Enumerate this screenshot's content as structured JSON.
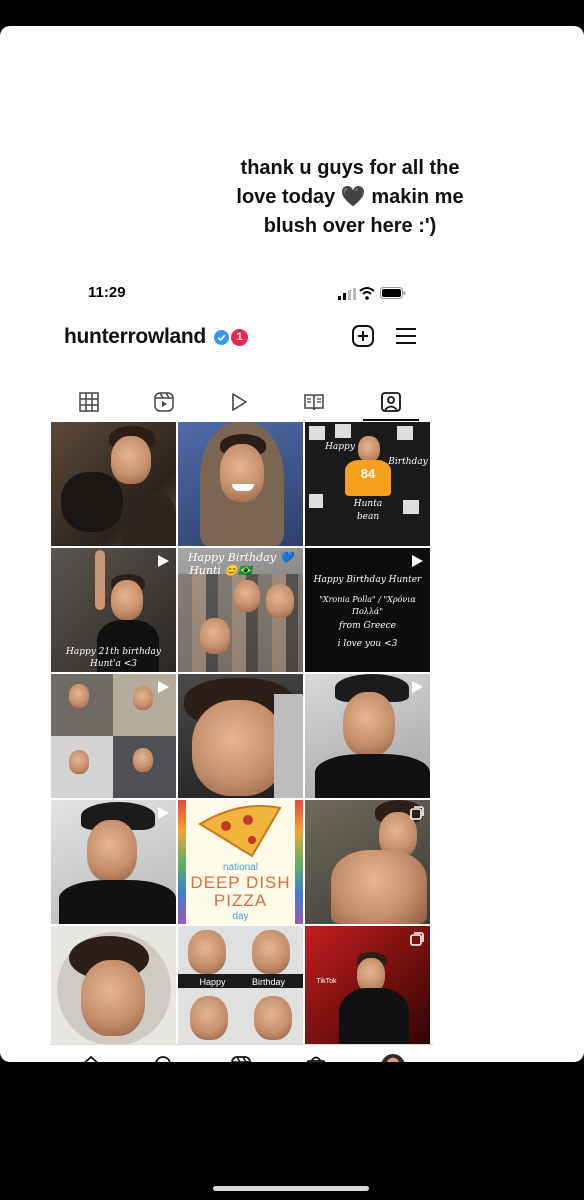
{
  "story": {
    "caption_line1": "thank u guys for all the",
    "caption_line2": "love today 🖤 makin me",
    "caption_line3": "blush over here :')"
  },
  "status_bar": {
    "time": "11:29",
    "icons": [
      "signal-icon",
      "wifi-icon",
      "battery-icon"
    ]
  },
  "profile": {
    "username": "hunterrowland",
    "verified": true,
    "notification_count": "1"
  },
  "tabs": [
    {
      "icon": "grid-icon",
      "active": false
    },
    {
      "icon": "reels-icon",
      "active": false
    },
    {
      "icon": "play-icon",
      "active": false
    },
    {
      "icon": "guide-icon",
      "active": false
    },
    {
      "icon": "tagged-icon",
      "active": true
    }
  ],
  "posts": {
    "t3_line1": "Happy",
    "t3_line2": "Birthday",
    "t3_line3": "Hunta",
    "t3_line4": "bean",
    "t3_jersey": "84",
    "t4_line1": "Happy 21th birthday",
    "t4_line2": "Hunt'a <3",
    "t5_line1": "Happy Birthday 💙",
    "t5_line2": "Hunti 😊🇧🇷",
    "t6_line1": "Happy Birthday Hunter",
    "t6_line2": "\"Xronia Polla\" / \"Χρόνια Πολλά\"",
    "t6_line3": "from Greece",
    "t6_line4": "i love you <3",
    "t11_line1": "national",
    "t11_line2": "DEEP DISH",
    "t11_line3": "PIZZA",
    "t11_line4": "day",
    "t14_line1": "Happy",
    "t14_line2": "Birthday",
    "t15_line1": "TikTok"
  },
  "bottom_nav": [
    "home-icon",
    "search-icon",
    "reels-icon",
    "shop-icon",
    "profile-avatar"
  ],
  "colors": {
    "badge": "#ed2553",
    "verified": "#3897f0",
    "background": "#000000"
  }
}
